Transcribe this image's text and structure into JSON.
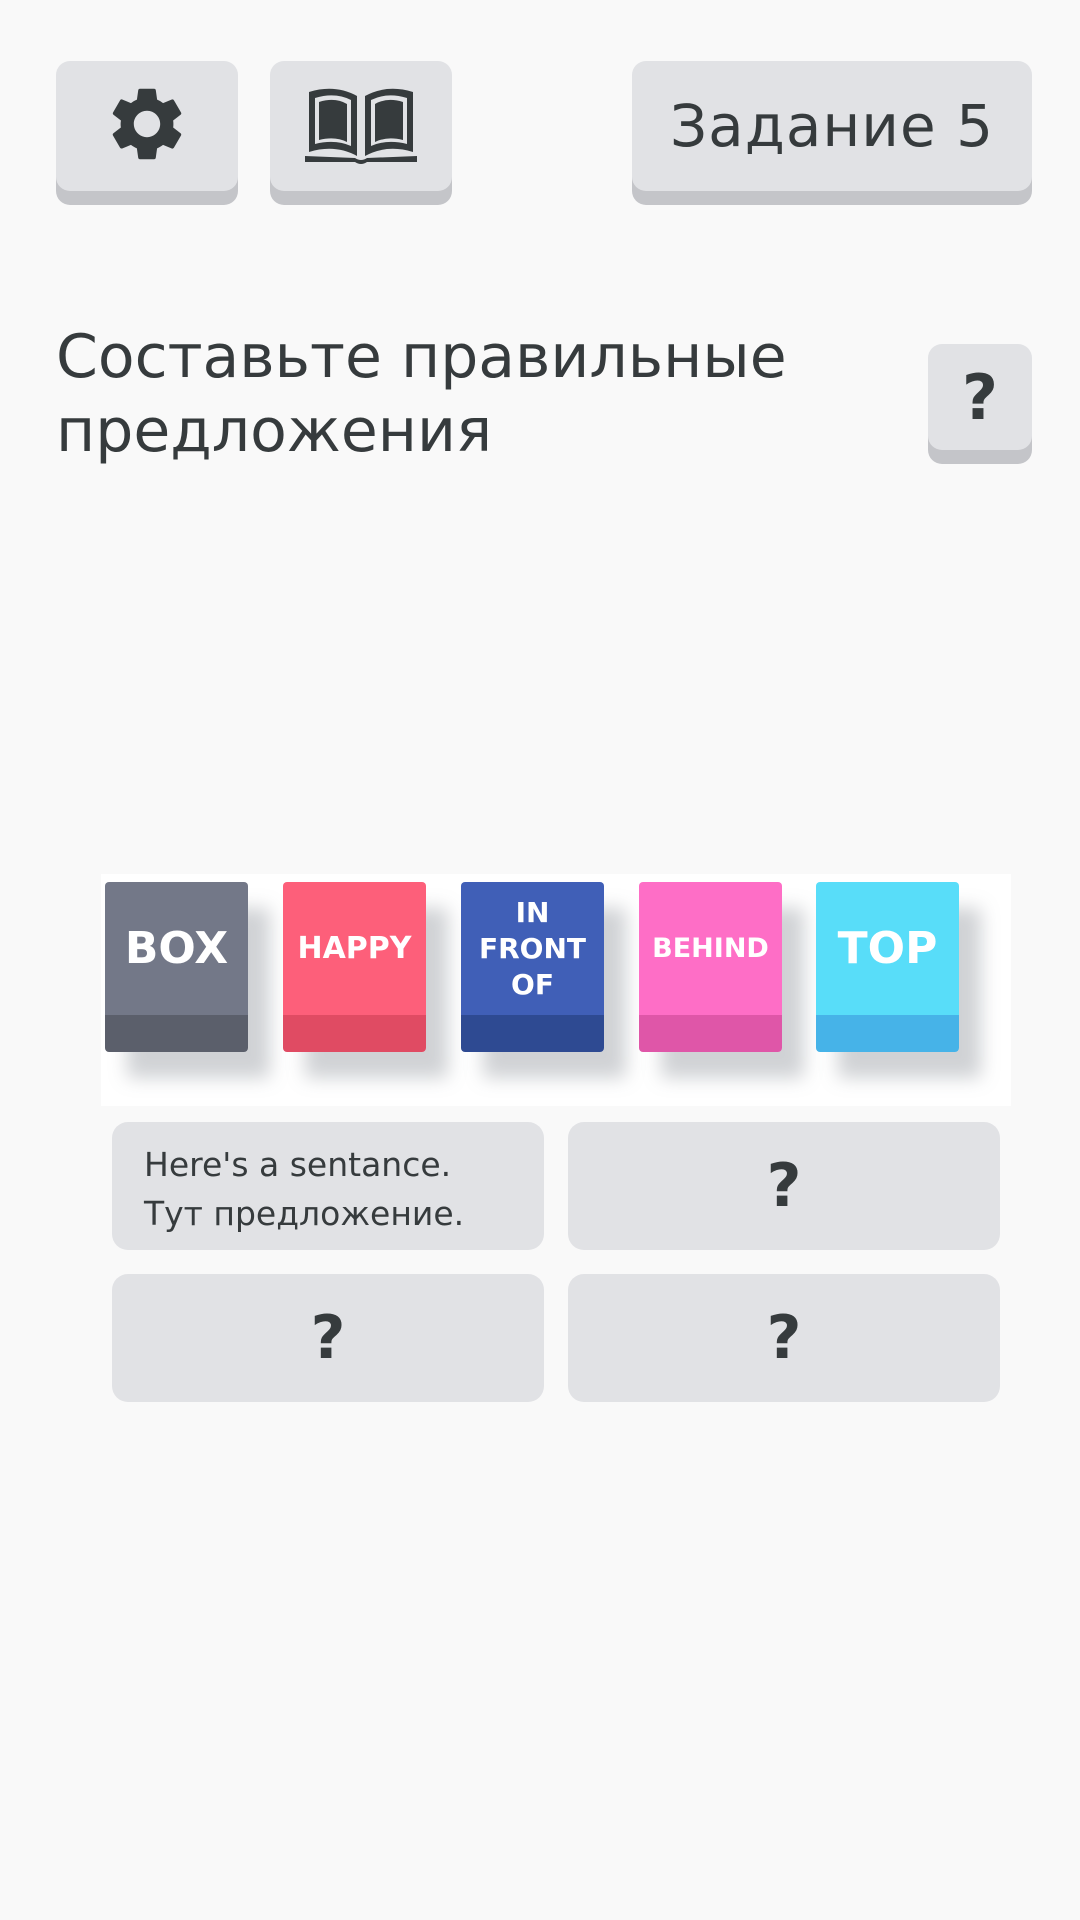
{
  "header": {
    "settings_icon": "gear-icon",
    "book_icon": "open-book-icon",
    "task_label": "Задание 5"
  },
  "instruction": {
    "title": "Составьте правильные предложения",
    "help_label": "?"
  },
  "blocks": [
    {
      "label": "BOX",
      "face_color": "#737888",
      "bottom_color": "#5b5f6b"
    },
    {
      "label": "HAPPY",
      "face_color": "#fd5f7a",
      "bottom_color": "#e04b63"
    },
    {
      "label": "IN FRONT OF",
      "face_color": "#405fb7",
      "bottom_color": "#2e4a92"
    },
    {
      "label": "BEHIND",
      "face_color": "#fe6ec6",
      "bottom_color": "#df56a8"
    },
    {
      "label": "TOP",
      "face_color": "#58ddf9",
      "bottom_color": "#46b3e8"
    }
  ],
  "answers": [
    {
      "line1": "Here's a sentance.",
      "line2": "Тут предложение."
    },
    {
      "label": "?"
    },
    {
      "label": "?"
    },
    {
      "label": "?"
    }
  ],
  "colors": {
    "background": "#f9f9f9",
    "button": "#e1e2e5",
    "button_shadow": "#c4c5c9",
    "text": "#363b3d"
  }
}
